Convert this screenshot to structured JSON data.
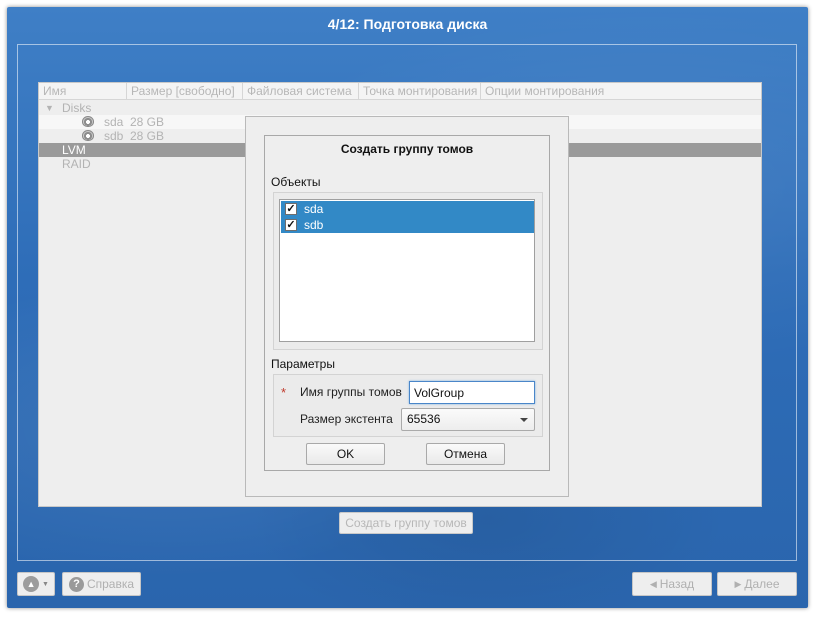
{
  "window": {
    "title": "4/12: Подготовка диска"
  },
  "disk_tree": {
    "columns": [
      "Имя",
      "Размер [свободно]",
      "Файловая система",
      "Точка монтирования",
      "Опции монтирования"
    ],
    "rows": [
      {
        "name": "Disks",
        "size": ""
      },
      {
        "name": "sda",
        "size": "28 GB"
      },
      {
        "name": "sdb",
        "size": "28 GB"
      },
      {
        "name": "LVM",
        "size": ""
      },
      {
        "name": "RAID",
        "size": ""
      }
    ]
  },
  "create_vg_button": "Создать группу томов",
  "dialog": {
    "title": "Создать группу томов",
    "objects_label": "Объекты",
    "objects": [
      {
        "label": "sda",
        "checked": true
      },
      {
        "label": "sdb",
        "checked": true
      }
    ],
    "params_label": "Параметры",
    "required_mark": "*",
    "vg_name_label": "Имя группы томов",
    "vg_name_value": "VolGroup",
    "extent_label": "Размер экстента",
    "extent_value": "65536",
    "ok_label": "OK",
    "cancel_label": "Отмена"
  },
  "bottom": {
    "help_label": "Справка",
    "back_label": "Назад",
    "next_label": "Далее"
  },
  "icons": {
    "disk": "hard-disk-icon",
    "help": "question-icon",
    "back": "chevron-left-icon",
    "next": "chevron-right-icon",
    "check": "checkmark-icon"
  },
  "colors": {
    "background": "#2e6db8",
    "selection": "#3289c6",
    "tree_selected": "#9a9a9a",
    "required": "#c0392b"
  }
}
